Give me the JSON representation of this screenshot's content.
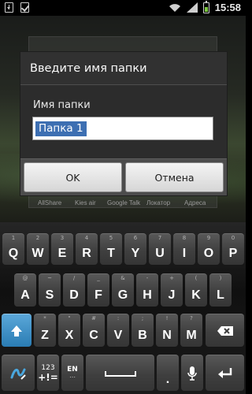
{
  "status_bar": {
    "time": "15:58",
    "left_icons": [
      "download-icon",
      "checkbox-notification-icon"
    ],
    "right_icons": [
      "wifi-icon",
      "signal-icon",
      "battery-icon"
    ]
  },
  "background_apps": {
    "labels": [
      "AllShare",
      "Kies air",
      "Google Talk",
      "Локатор",
      "Адреса"
    ]
  },
  "dialog": {
    "title": "Введите имя папки",
    "field_label": "Имя папки",
    "field_value": "Папка 1",
    "ok_label": "OK",
    "cancel_label": "Отмена"
  },
  "keyboard": {
    "row1": [
      {
        "main": "Q",
        "hint": "1"
      },
      {
        "main": "W",
        "hint": "2"
      },
      {
        "main": "E",
        "hint": "3"
      },
      {
        "main": "R",
        "hint": "4"
      },
      {
        "main": "T",
        "hint": "5"
      },
      {
        "main": "Y",
        "hint": "6"
      },
      {
        "main": "U",
        "hint": "7"
      },
      {
        "main": "I",
        "hint": "8"
      },
      {
        "main": "O",
        "hint": "9"
      },
      {
        "main": "P",
        "hint": "0"
      }
    ],
    "row2": [
      {
        "main": "A",
        "hint": "@"
      },
      {
        "main": "S",
        "hint": "~"
      },
      {
        "main": "D",
        "hint": "/"
      },
      {
        "main": "F",
        "hint": "_"
      },
      {
        "main": "G",
        "hint": "&"
      },
      {
        "main": "H",
        "hint": "-"
      },
      {
        "main": "J",
        "hint": "+"
      },
      {
        "main": "K",
        "hint": "("
      },
      {
        "main": "L",
        "hint": ")"
      }
    ],
    "row3": [
      {
        "main": "Z",
        "hint": "*"
      },
      {
        "main": "X",
        "hint": "\""
      },
      {
        "main": "C",
        "hint": "#"
      },
      {
        "main": "V",
        "hint": ":"
      },
      {
        "main": "B",
        "hint": ";"
      },
      {
        "main": "N",
        "hint": "!"
      },
      {
        "main": "M",
        "hint": "?"
      }
    ],
    "sym_key": {
      "line1": "123",
      "line2": "+!="
    },
    "lang_key": {
      "line1": "EN",
      "line2": "⋯"
    },
    "period": ".",
    "accent_color": "#2a7cb3"
  }
}
